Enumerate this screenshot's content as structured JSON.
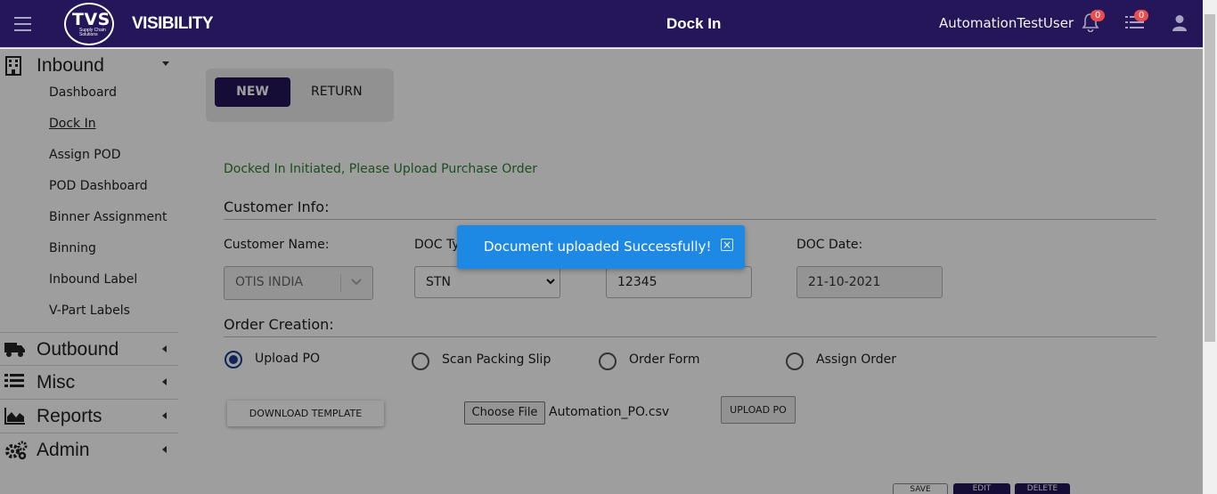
{
  "header": {
    "brand_logo": "TVS",
    "brand_logo_sub": "Supply Chain Solutions",
    "brand": "VISIBILITY",
    "page_title": "Dock In",
    "user": "AutomationTestUser",
    "notifications_count": "0",
    "tasks_count": "0"
  },
  "sidebar": {
    "inbound": {
      "label": "Inbound",
      "items": [
        "Dashboard",
        "Dock In",
        "Assign POD",
        "POD Dashboard",
        "Binner Assignment",
        "Binning",
        "Inbound Label",
        "V-Part Labels"
      ]
    },
    "outbound": "Outbound",
    "misc": "Misc",
    "reports": "Reports",
    "admin": "Admin"
  },
  "tabs": {
    "new": "NEW",
    "return": "RETURN"
  },
  "status_message": "Docked In Initiated, Please Upload Purchase Order",
  "customer_info": {
    "heading": "Customer Info:",
    "customer_name_label": "Customer Name:",
    "customer_name_value": "OTIS INDIA",
    "doc_type_label": "DOC Ty",
    "doc_type_value": "STN",
    "doc_no_value": "12345",
    "doc_date_label": "DOC Date:",
    "doc_date_value": "21-10-2021"
  },
  "order_creation": {
    "heading": "Order Creation:",
    "options": [
      "Upload PO",
      "Scan Packing Slip",
      "Order Form",
      "Assign Order"
    ],
    "selected": "Upload PO"
  },
  "actions": {
    "download_template": "DOWNLOAD TEMPLATE",
    "choose_file": "Choose File",
    "file_name": "Automation_PO.csv",
    "upload_po": "UPLOAD PO",
    "bottom_buttons": [
      "SAVE",
      "EDIT",
      "DELETE"
    ]
  },
  "toast": {
    "message": "Document uploaded Successfully!",
    "close": "×"
  },
  "colors": {
    "header_bg": "#241658",
    "toast_bg": "#1e88e5",
    "status_green": "#2e7d32",
    "badge": "#e94f4f"
  }
}
